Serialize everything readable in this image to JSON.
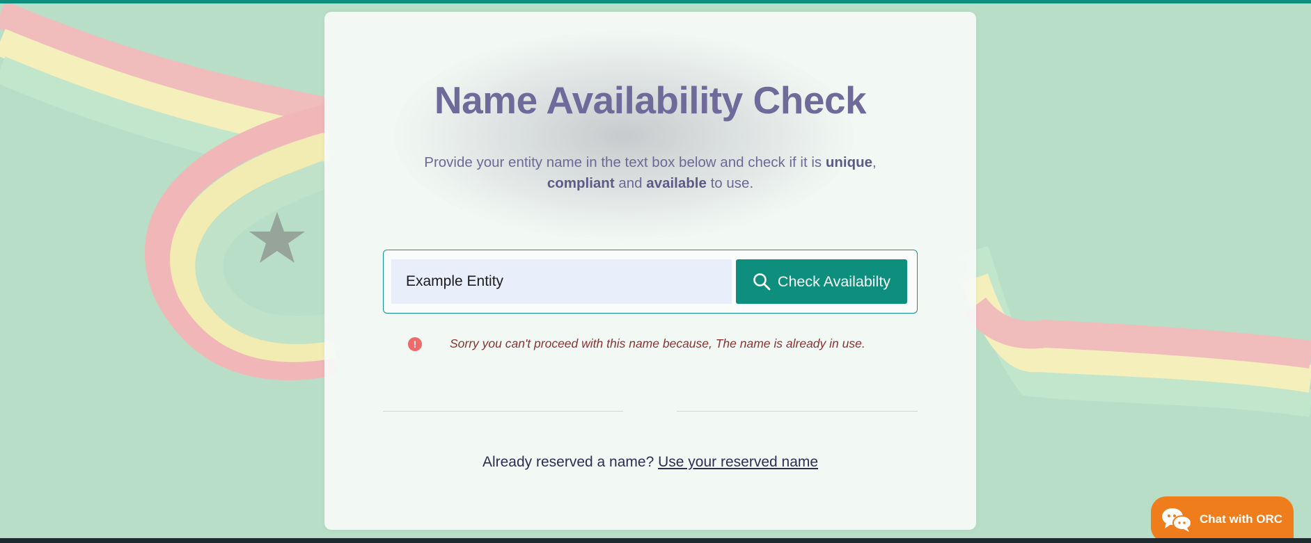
{
  "page": {
    "title": "Name Availability Check",
    "subtitle": {
      "part1": "Provide your entity name in the text box below and check if it is ",
      "bold1": "unique",
      "part2": ",",
      "bold2": "compliant",
      "part3": " and ",
      "bold3": "available",
      "part4": " to use."
    }
  },
  "search": {
    "value": "Example Entity",
    "button_label": "Check Availabilty"
  },
  "error": {
    "icon": "!",
    "message": "Sorry you can't proceed with this name because, The name is already in use."
  },
  "reserved": {
    "prompt": "Already reserved a name?",
    "link": "Use your reserved name"
  },
  "chat": {
    "label": "Chat with ORC"
  },
  "icons": {
    "search": "search-icon",
    "error": "error-icon",
    "chat": "chat-bubbles-icon"
  },
  "colors": {
    "accent": "#0e8f7e",
    "title": "#6f6a99",
    "error": "#ef6b6b",
    "chat": "#f07d1b"
  }
}
